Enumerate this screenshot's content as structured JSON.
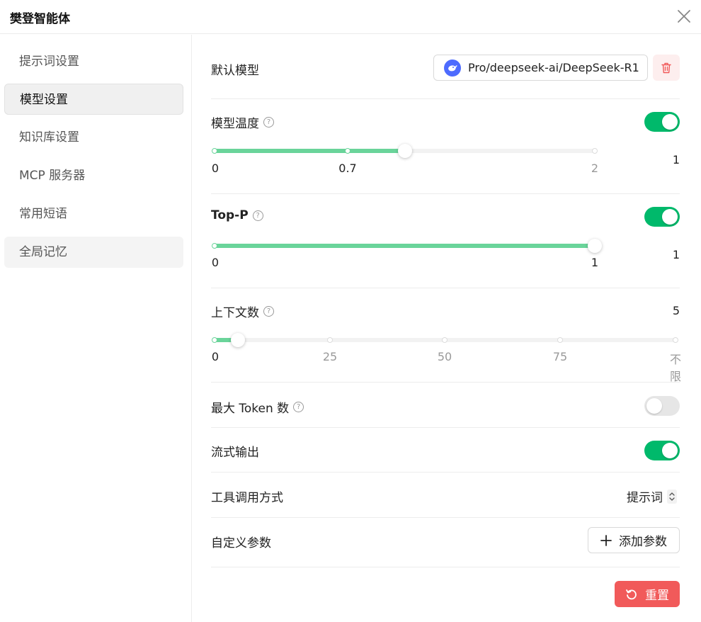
{
  "header": {
    "title": "樊登智能体"
  },
  "sidebar": {
    "items": [
      {
        "label": "提示词设置"
      },
      {
        "label": "模型设置"
      },
      {
        "label": "知识库设置"
      },
      {
        "label": "MCP 服务器"
      },
      {
        "label": "常用短语"
      },
      {
        "label": "全局记忆"
      }
    ],
    "active_index": 1
  },
  "main": {
    "default_model": {
      "label": "默认模型",
      "model_name": "Pro/deepseek-ai/DeepSeek-R1"
    },
    "temperature": {
      "label": "模型温度",
      "enabled": true,
      "value": 1,
      "value_text": "1",
      "min": 0,
      "max": 2,
      "marks": [
        "0",
        "0.7",
        "2"
      ],
      "mark_values": [
        0,
        0.7,
        2
      ]
    },
    "top_p": {
      "label": "Top-P",
      "enabled": true,
      "value": 1,
      "value_text": "1",
      "min": 0,
      "max": 1,
      "marks": [
        "0",
        "1"
      ],
      "mark_values": [
        0,
        1
      ]
    },
    "context_count": {
      "label": "上下文数",
      "value": 5,
      "value_text": "5",
      "marks": [
        "0",
        "25",
        "50",
        "75",
        "不限"
      ]
    },
    "max_tokens": {
      "label": "最大 Token 数",
      "enabled": false
    },
    "stream_output": {
      "label": "流式输出",
      "enabled": true
    },
    "tool_call_mode": {
      "label": "工具调用方式",
      "value": "提示词"
    },
    "custom_params": {
      "label": "自定义参数",
      "add_label": "添加参数"
    },
    "reset_label": "重置"
  },
  "colors": {
    "accent": "#00b96b",
    "slider_fill": "#6ad49a",
    "danger": "#f15a5a"
  }
}
